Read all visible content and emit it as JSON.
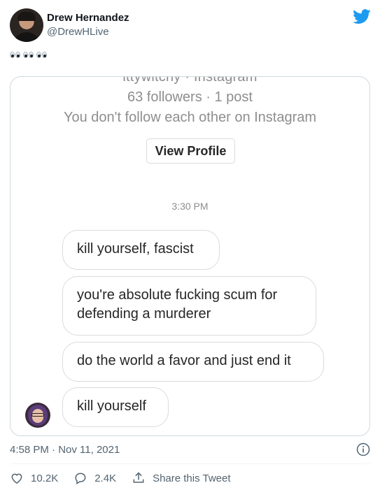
{
  "author": {
    "name": "Drew Hernandez",
    "handle": "@DrewHLive"
  },
  "tweet": {
    "emoji_text": "👀👀👀",
    "timestamp": "4:58 PM · Nov 11, 2021"
  },
  "screenshot": {
    "cut_off_title": "ittywitchy · Instagram",
    "stats": "63 followers · 1 post",
    "follow_note": "You don't follow each other on Instagram",
    "view_profile_label": "View Profile",
    "message_time": "3:30 PM",
    "messages": [
      "kill yourself, fascist",
      "you're absolute fucking scum for defending a murderer",
      "do the world a favor and just end it",
      "kill yourself"
    ]
  },
  "actions": {
    "likes": "10.2K",
    "replies": "2.4K",
    "share_label": "Share this Tweet"
  },
  "colors": {
    "twitter_blue": "#1d9bf0",
    "text_secondary": "#536471",
    "instagram_gray": "#8e8e8e"
  }
}
